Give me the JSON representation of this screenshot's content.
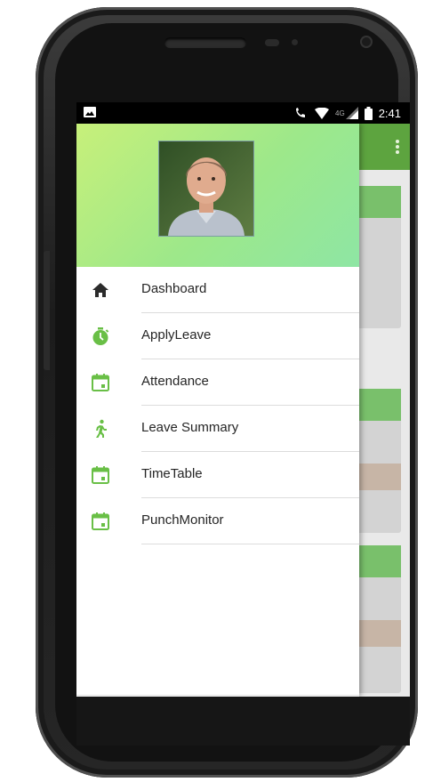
{
  "status_bar": {
    "time": "2:41",
    "network_label": "4G"
  },
  "drawer": {
    "items": [
      {
        "label": "Dashboard",
        "icon": "home-icon"
      },
      {
        "label": "ApplyLeave",
        "icon": "timer-icon"
      },
      {
        "label": "Attendance",
        "icon": "calendar-icon"
      },
      {
        "label": "Leave Summary",
        "icon": "walk-icon"
      },
      {
        "label": "TimeTable",
        "icon": "calendar-icon"
      },
      {
        "label": "PunchMonitor",
        "icon": "calendar-icon"
      }
    ]
  },
  "colors": {
    "accent": "#5da43f",
    "icon_green": "#69bf46",
    "header_gradient_start": "#c7f07a",
    "header_gradient_end": "#8ee6a4"
  }
}
